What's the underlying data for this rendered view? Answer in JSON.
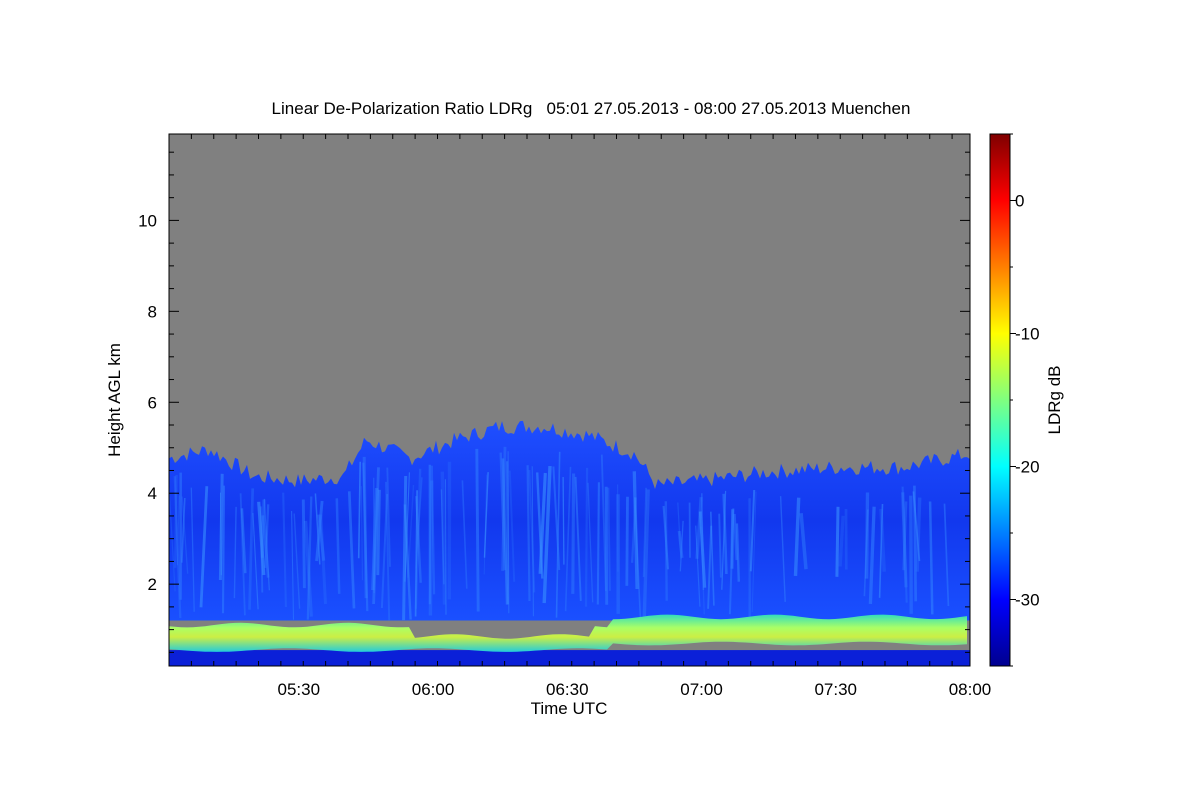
{
  "chart_data": {
    "type": "heatmap",
    "title": "Linear De-Polarization Ratio LDRg   05:01 27.05.2013 - 08:00 27.05.2013 Muenchen",
    "xlabel": "Time UTC",
    "ylabel": "Height AGL km",
    "x_range": [
      "05:01",
      "08:00"
    ],
    "ylim": [
      0.2,
      11.9
    ],
    "x_ticks": [
      "05:30",
      "06:00",
      "06:30",
      "07:00",
      "07:30",
      "08:00"
    ],
    "y_ticks": [
      2,
      4,
      6,
      8,
      10
    ],
    "colorbar": {
      "label": "LDRg dB",
      "range": [
        -35,
        5
      ],
      "ticks": [
        0,
        -10,
        -20,
        -30
      ],
      "colormap": "jet"
    },
    "no_data_color": "#808080",
    "cloud_top_km": [
      {
        "time": "05:01",
        "top": 4.7
      },
      {
        "time": "05:10",
        "top": 4.9
      },
      {
        "time": "05:20",
        "top": 4.3
      },
      {
        "time": "05:30",
        "top": 4.2
      },
      {
        "time": "05:40",
        "top": 4.3
      },
      {
        "time": "05:45",
        "top": 5.1
      },
      {
        "time": "05:55",
        "top": 4.7
      },
      {
        "time": "06:05",
        "top": 5.1
      },
      {
        "time": "06:15",
        "top": 5.4
      },
      {
        "time": "06:25",
        "top": 5.4
      },
      {
        "time": "06:35",
        "top": 5.2
      },
      {
        "time": "06:45",
        "top": 4.8
      },
      {
        "time": "06:50",
        "top": 4.1
      },
      {
        "time": "07:00",
        "top": 4.2
      },
      {
        "time": "07:15",
        "top": 4.4
      },
      {
        "time": "07:30",
        "top": 4.5
      },
      {
        "time": "07:45",
        "top": 4.5
      },
      {
        "time": "08:00",
        "top": 4.8
      }
    ],
    "layers": [
      {
        "name": "boundary-layer band",
        "height_km": [
          0.55,
          1.1
        ],
        "ldr_db": -20
      },
      {
        "name": "surface layer",
        "height_km": [
          0.2,
          0.55
        ],
        "ldr_db": -33
      },
      {
        "name": "ice cloud",
        "height_km": [
          1.2,
          5.4
        ],
        "ldr_db": -29
      }
    ]
  }
}
